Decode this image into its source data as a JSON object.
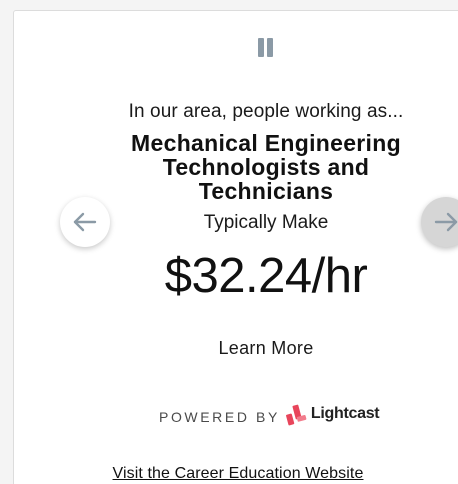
{
  "widget": {
    "intro_text": "In our area, people working as...",
    "occupation_lines": [
      "Mechanical Engineering",
      "Technologists and",
      "Technicians"
    ],
    "typically_make_label": "Typically Make",
    "wage_value": "$32.24/hr",
    "learn_more_label": "Learn More",
    "powered_by_label": "POWERED BY",
    "brand_name": "Lightcast",
    "visit_link_label": "Visit the Career Education Website"
  },
  "controls": {
    "pause_icon": "pause-icon",
    "prev_icon": "arrow-left-icon",
    "next_icon": "arrow-right-icon"
  },
  "colors": {
    "icon_gray": "#8b9aa6",
    "brand_red": "#e8455b",
    "brand_pink": "#f27c8c"
  }
}
